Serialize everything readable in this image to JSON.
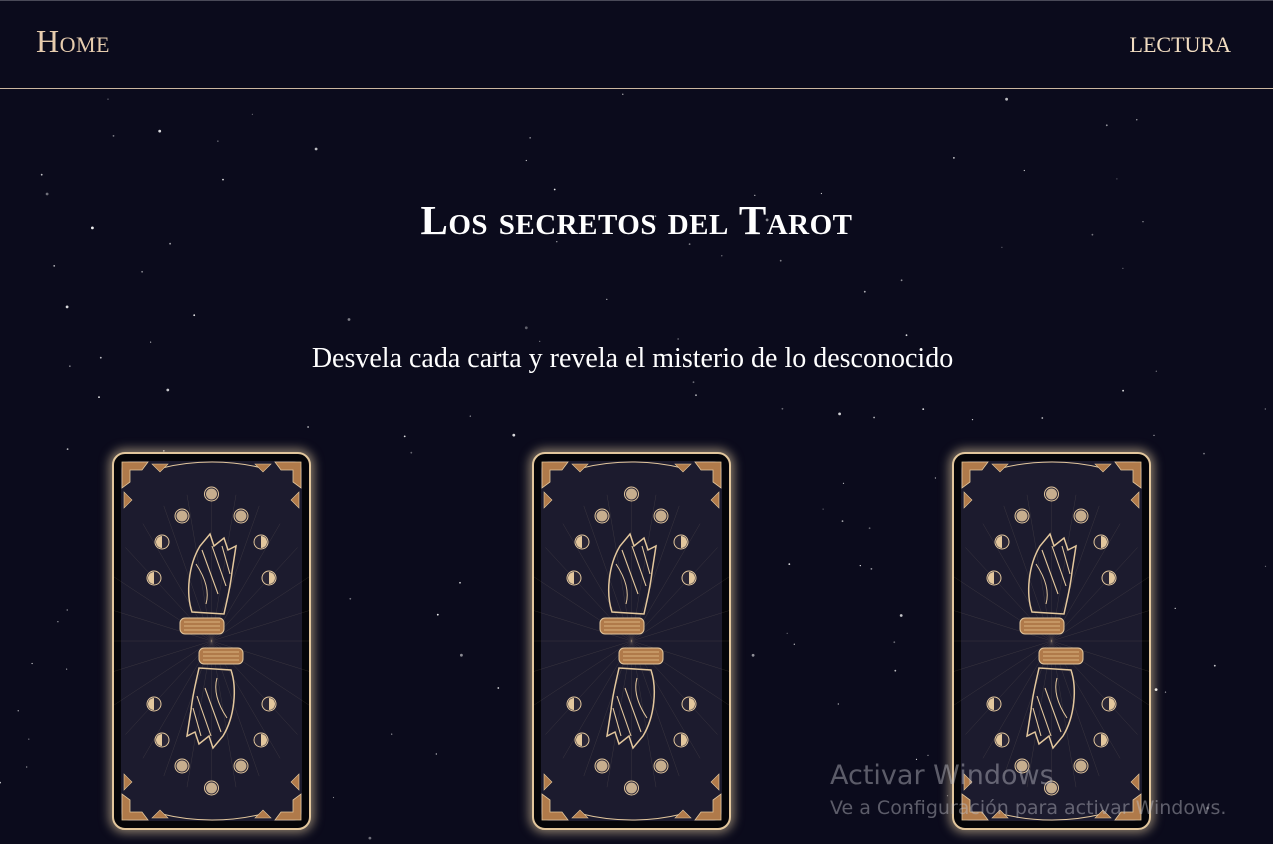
{
  "nav": {
    "home_label": "Home",
    "lectura_label": "LECTURA"
  },
  "hero": {
    "title": "Los secretos del Tarot",
    "subtitle": "Desvela cada carta y revela el misterio de lo desconocido"
  },
  "cards": [
    {
      "name": "tarot-card-back"
    },
    {
      "name": "tarot-card-back"
    },
    {
      "name": "tarot-card-back"
    }
  ],
  "watermark": {
    "title": "Activar Windows",
    "subtitle": "Ve a Configuración para activar Windows."
  },
  "colors": {
    "background": "#0b0b1c",
    "gold": "#e3c79d",
    "card_face": "#1c1b2e",
    "text": "#ffffff"
  }
}
